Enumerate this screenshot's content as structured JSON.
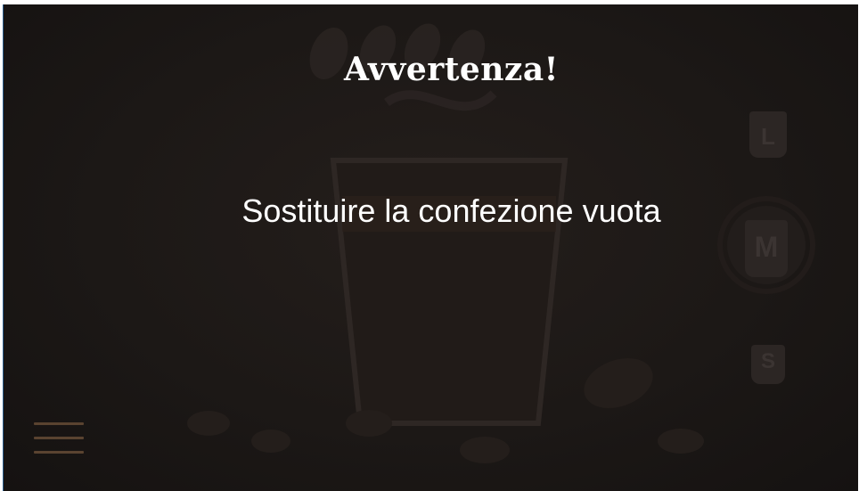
{
  "dialog": {
    "title": "Avvertenza!",
    "message": "Sostituire la confezione vuota"
  },
  "menu": {
    "icon": "hamburger-menu-icon"
  },
  "cup_sizes": [
    {
      "letter": "L",
      "selected": false
    },
    {
      "letter": "M",
      "selected": true
    },
    {
      "letter": "S",
      "selected": false
    }
  ],
  "colors": {
    "background": "#1c1816",
    "text": "#ffffff",
    "menu_accent": "#5a4330",
    "left_edge": "#2b5d8c"
  }
}
